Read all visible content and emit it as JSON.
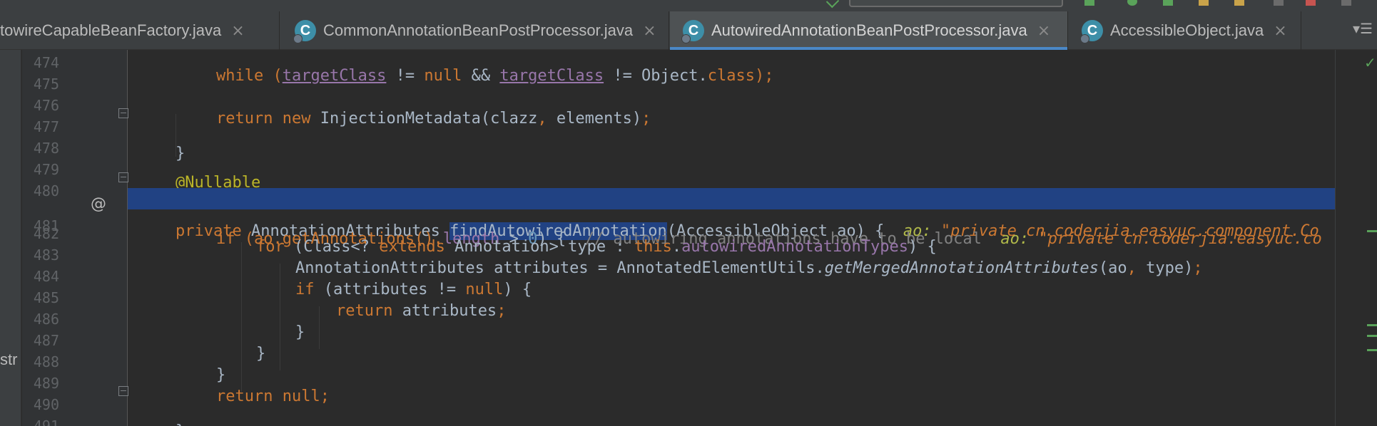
{
  "tabs": [
    {
      "label": "towireCapableBeanFactory.java",
      "icon": "",
      "active": false
    },
    {
      "label": "CommonAnnotationBeanPostProcessor.java",
      "icon": "C",
      "active": false
    },
    {
      "label": "AutowiredAnnotationBeanPostProcessor.java",
      "icon": "C",
      "active": true
    },
    {
      "label": "AccessibleObject.java",
      "icon": "C",
      "active": false
    }
  ],
  "tab_close_glyph": "×",
  "tab_menu_glyph": "▾☰",
  "left_panel_fragment": "str",
  "gutter_marker": "@",
  "line_numbers": [
    "474",
    "475",
    "476",
    "477",
    "478",
    "479",
    "480",
    "481",
    "482",
    "483",
    "484",
    "485",
    "486",
    "487",
    "488",
    "489",
    "490",
    "491"
  ],
  "code": {
    "l474_a": "while (",
    "l474_b": "targetClass",
    "l474_c": " != ",
    "l474_d": "null",
    "l474_e": " && ",
    "l474_f": "targetClass",
    "l474_g": " != Object.",
    "l474_h": "class",
    "l474_i": ");",
    "l476_a": "return",
    "l476_b": " ",
    "l476_c": "new",
    "l476_d": " InjectionMetadata(clazz",
    "l476_e": ",",
    "l476_f": " elements)",
    "l476_g": ";",
    "l477": "}",
    "l479": "@Nullable",
    "l480_a": "private",
    "l480_b": " AnnotationAttributes ",
    "l480_c": "findAutowiredAnnotation",
    "l480_d": "(AccessibleObject ao) {  ",
    "l480_hint_name": "ao:",
    "l480_hint_val": " \"private cn.coderjia.easyuc.component.Co",
    "l481_a": "if (ao.getAnnotations().",
    "l481_b": "length",
    "l481_c": " > ",
    "l481_d": "0",
    "l481_e": ") {  ",
    "l481_cmt": "// autowiring annotations have to be local  ",
    "l481_hint_name": "ao:",
    "l481_hint_val": " \"private cn.coderjia.easyuc.co",
    "l482_a": "for",
    "l482_b": " (Class<? ",
    "l482_c": "extends",
    "l482_d": " Annotation> type : ",
    "l482_e": "this",
    "l482_f": ".",
    "l482_g": "autowiredAnnotationTypes",
    "l482_h": ") {",
    "l483_a": "AnnotationAttributes attributes = AnnotatedElementUtils.",
    "l483_b": "getMergedAnnotationAttributes",
    "l483_c": "(ao",
    "l483_d": ",",
    "l483_e": " type)",
    "l483_f": ";",
    "l484_a": "if",
    "l484_b": " (attributes != ",
    "l484_c": "null",
    "l484_d": ") {",
    "l485_a": "return",
    "l485_b": " attributes",
    "l485_c": ";",
    "l486": "}",
    "l487": "}",
    "l488": "}",
    "l489_a": "return",
    "l489_b": " ",
    "l489_c": "null",
    "l489_d": ";",
    "l490": "}"
  },
  "scroll_check_glyph": "✓",
  "colors": {
    "background": "#2b2b2b",
    "keyword": "#cc7832",
    "annotation": "#bbb529",
    "number": "#6897bb",
    "field": "#9876aa",
    "comment": "#808080",
    "selection": "#214283",
    "active_tab_underline": "#4a88c7"
  }
}
